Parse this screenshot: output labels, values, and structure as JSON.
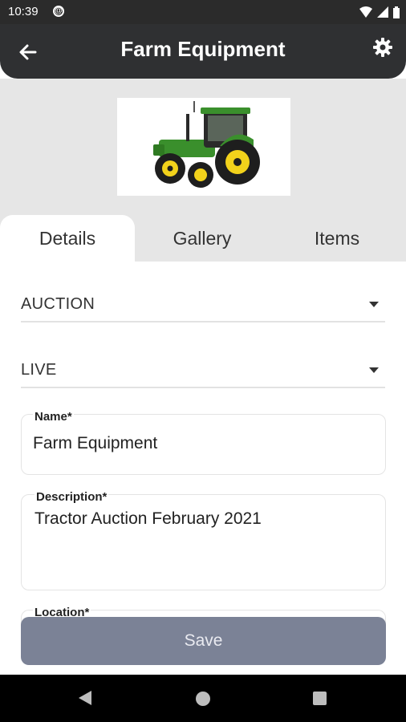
{
  "status_bar": {
    "time": "10:39"
  },
  "app_bar": {
    "title": "Farm Equipment"
  },
  "tabs": [
    {
      "label": "Details",
      "active": true
    },
    {
      "label": "Gallery",
      "active": false
    },
    {
      "label": "Items",
      "active": false
    }
  ],
  "form": {
    "type_select": {
      "value": "AUCTION"
    },
    "mode_select": {
      "value": "LIVE"
    },
    "name": {
      "label": "Name*",
      "value": "Farm Equipment"
    },
    "description": {
      "label": "Description*",
      "value": "Tractor Auction February 2021"
    },
    "location": {
      "label": "Location*"
    },
    "save_label": "Save"
  },
  "colors": {
    "app_bar": "#2f3032",
    "header_bg": "#e6e6e6",
    "save_button": "#7b8296",
    "tractor_green": "#3a8f2c",
    "tractor_yellow": "#f2d21b"
  }
}
